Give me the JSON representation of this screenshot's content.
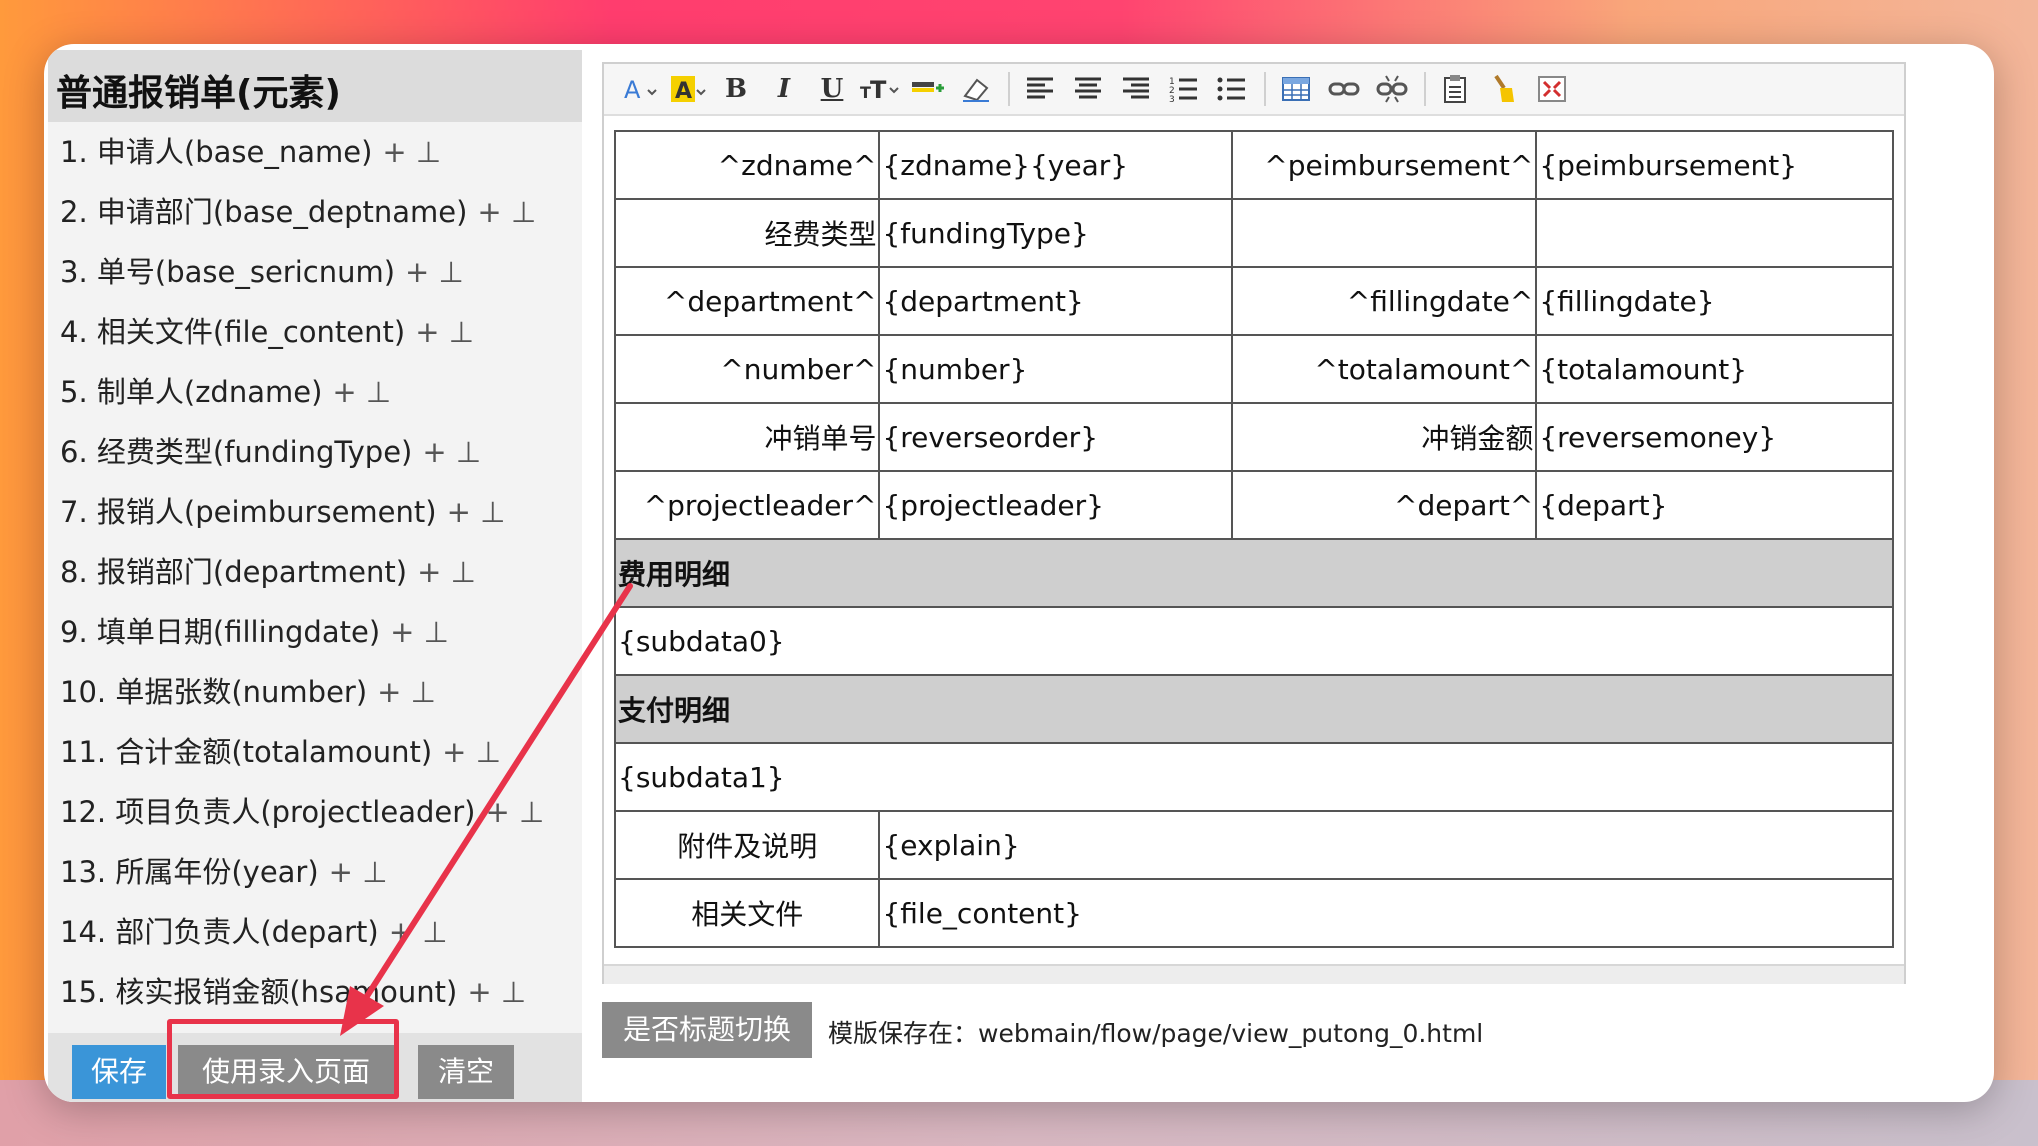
{
  "left_panel": {
    "title": "普通报销单(元素)",
    "ops": "+ ⊥",
    "fields": [
      "1. 申请人(base_name)",
      "2. 申请部门(base_deptname)",
      "3. 单号(base_sericnum)",
      "4. 相关文件(file_content)",
      "5. 制单人(zdname)",
      "6. 经费类型(fundingType)",
      "7. 报销人(peimbursement)",
      "8. 报销部门(department)",
      "9. 填单日期(fillingdate)",
      "10. 单据张数(number)",
      "11. 合计金额(totalamount)",
      "12. 项目负责人(projectleader)",
      "13. 所属年份(year)",
      "14. 部门负责人(depart)",
      "15. 核实报销金额(hsamount)"
    ],
    "buttons": {
      "save": "保存",
      "use_entry_page": "使用录入页面",
      "clear": "清空"
    }
  },
  "toolbar": {
    "icons": [
      "font-size-icon",
      "font-color-icon",
      "bold-icon",
      "italic-icon",
      "underline-icon",
      "text-size-icon",
      "highlight-icon",
      "eraser-icon",
      "align-left-icon",
      "align-center-icon",
      "align-right-icon",
      "ordered-list-icon",
      "unordered-list-icon",
      "table-icon",
      "link-icon",
      "unlink-icon",
      "paste-icon",
      "format-brush-icon",
      "fullscreen-icon"
    ]
  },
  "form_table": {
    "r1": {
      "l1": "^zdname^",
      "v1": "{zdname}{year}",
      "l2": "^peimbursement^",
      "v2": "{peimbursement}"
    },
    "r2": {
      "l1": "经费类型",
      "v1": "{fundingType}",
      "l2": "",
      "v2": ""
    },
    "r3": {
      "l1": "^department^",
      "v1": "{department}",
      "l2": "^fillingdate^",
      "v2": "{fillingdate}"
    },
    "r4": {
      "l1": "^number^",
      "v1": "{number}",
      "l2": "^totalamount^",
      "v2": "{totalamount}"
    },
    "r5": {
      "l1": "冲销单号",
      "v1": "{reverseorder}",
      "l2": "冲销金额",
      "v2": "{reversemoney}"
    },
    "r6": {
      "l1": "^projectleader^",
      "v1": "{projectleader}",
      "l2": "^depart^",
      "v2": "{depart}"
    },
    "section1": "费用明细",
    "subdata0": "{subdata0}",
    "section2": "支付明细",
    "subdata1": "{subdata1}",
    "r7": {
      "l1": "附件及说明",
      "v1": "{explain}"
    },
    "r8": {
      "l1": "相关文件",
      "v1": "{file_content}"
    }
  },
  "bottom": {
    "toggle_button": "是否标题切换",
    "save_path": "模版保存在：webmain/flow/page/view_putong_0.html"
  },
  "colors": {
    "save_button": "#3a95d8",
    "gray_button": "#8a8a8a",
    "highlight": "#e8334a"
  }
}
